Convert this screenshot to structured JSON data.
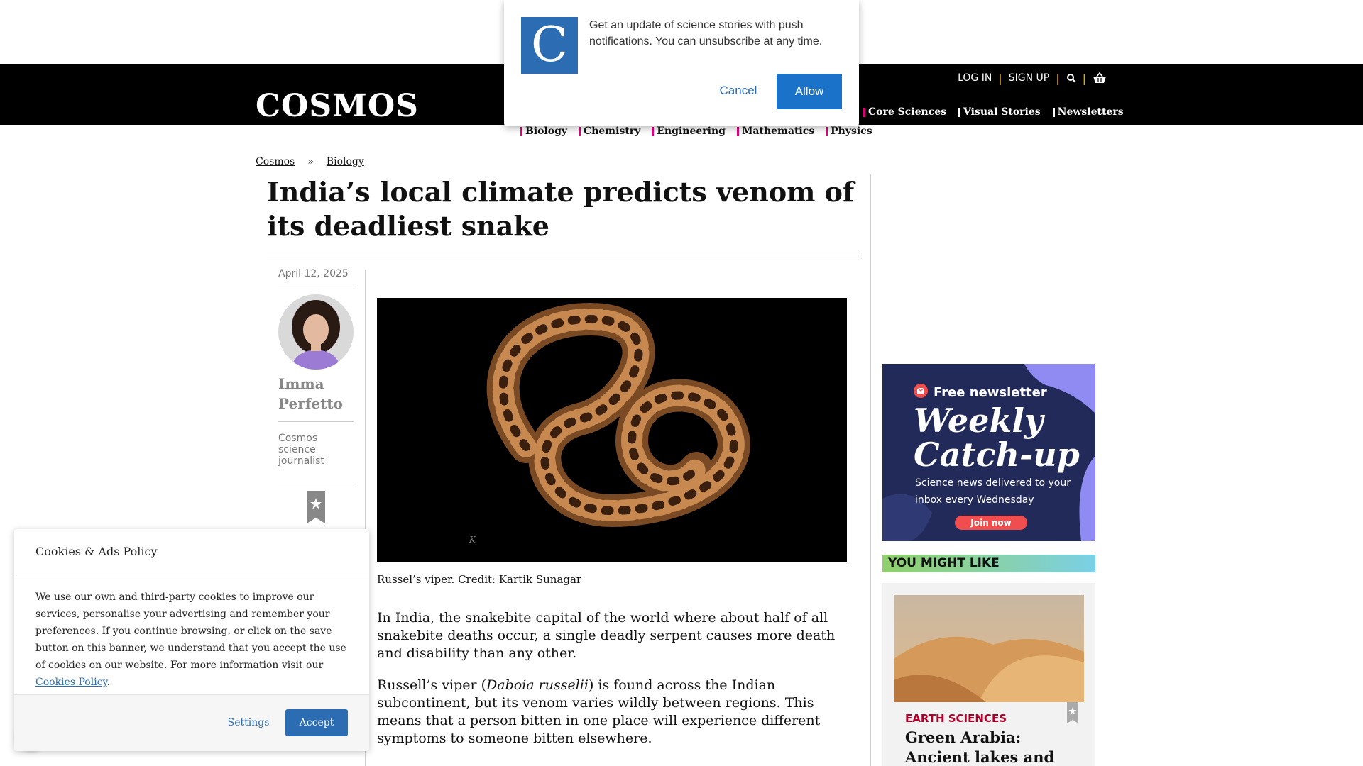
{
  "header": {
    "logo": "COSMOS",
    "auth": {
      "login": "LOG IN",
      "signup": "SIGN UP"
    },
    "nav": [
      {
        "label": "Core Sciences"
      },
      {
        "label": "Visual Stories"
      },
      {
        "label": "Newsletters"
      }
    ],
    "subnav": [
      {
        "label": "Biology"
      },
      {
        "label": "Chemistry"
      },
      {
        "label": "Engineering"
      },
      {
        "label": "Mathematics"
      },
      {
        "label": "Physics"
      }
    ]
  },
  "push_prompt": {
    "logo_letter": "C",
    "message": "Get an update of science stories with push notifications. You can unsubscribe at any time.",
    "cancel_label": "Cancel",
    "allow_label": "Allow"
  },
  "breadcrumb": {
    "home": "Cosmos",
    "separator": "»",
    "section": "Biology"
  },
  "article": {
    "title": "India’s local climate predicts venom of its deadliest snake",
    "date": "April 12, 2025",
    "author": {
      "name": "Imma Perfetto",
      "role": "Cosmos science journalist"
    },
    "image_caption": "Russel’s viper. Credit: Kartik Sunagar",
    "paragraph_1": "In India, the snakebite capital of the world where about half of all snakebite deaths occur, a single deadly serpent causes more death and disability than any other.",
    "paragraph_2_before": "Russell’s viper (",
    "paragraph_2_species": "Daboia russelii",
    "paragraph_2_after": ") is found across the Indian subcontinent, but its venom varies wildly between regions. This means that a person bitten in one place will experience different symptoms to someone bitten elsewhere."
  },
  "sidebar": {
    "newsletter": {
      "badge": "Free newsletter",
      "title": "Weekly Catch-up",
      "subtitle": "Science news delivered to your inbox every Wednesday",
      "button": "Join now"
    },
    "you_might_like": "YOU MIGHT LIKE",
    "related": {
      "category": "EARTH SCIENCES",
      "title": "Green Arabia: Ancient lakes and rivers"
    }
  },
  "cookie_banner": {
    "title": "Cookies & Ads Policy",
    "body": "We use our own and third-party cookies to improve our services, personalise your advertising and remember your preferences. If you continue browsing, or click on the save button on this banner, we understand that you accept the use of cookies on our website. For more information visit our",
    "link_label": "Cookies Policy",
    "settings_label": "Settings",
    "accept_label": "Accept"
  },
  "colors": {
    "nav_accent": "#e4007c",
    "auth_separator": "#f5a300",
    "primary_button": "#1a73c9",
    "category_red": "#b0002a"
  }
}
